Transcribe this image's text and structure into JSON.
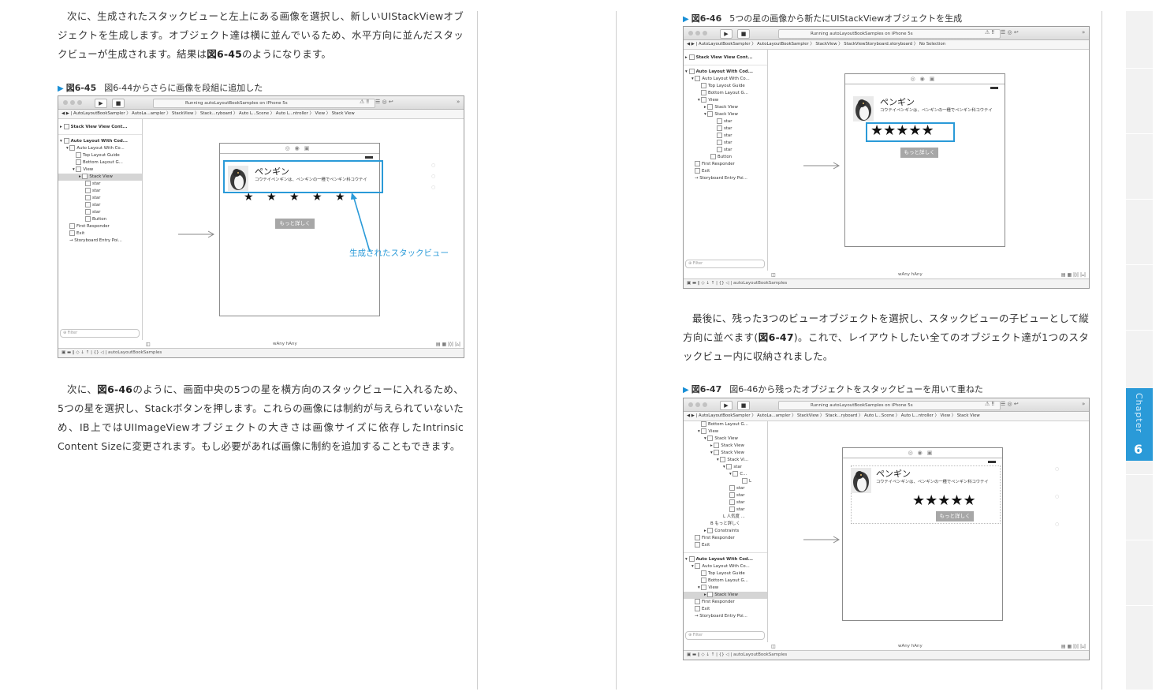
{
  "left_page": {
    "para1": "次に、生成されたスタックビューと左上にある画像を選択し、新しいUIStackViewオブジェクトを生成します。オブジェクト達は横に並んでいるため、水平方向に並んだスタックビューが生成されます。結果は",
    "para1_ref": "図6-45",
    "para1_tail": "のようになります。",
    "fig45_num": "図6-45",
    "fig45_caption": "図6-44からさらに画像を段組に追加した",
    "para2_a": "次に、",
    "para2_ref": "図6-46",
    "para2_b": "のように、画面中央の5つの星を横方向のスタックビューに入れるため、5つの星を選択し、Stackボタンを押します。これらの画像には制約が与えられていないため、IB上ではUIImageViewオブジェクトの大きさは画像サイズに依存したIntrinsic Content Sizeに変更されます。もし必要があれば画像に制約を追加することもできます。"
  },
  "right_page": {
    "fig46_num": "図6-46",
    "fig46_caption": "5つの星の画像から新たにUIStackViewオブジェクトを生成",
    "para3_a": "最後に、残った3つのビューオブジェクトを選択し、スタックビューの子ビューとして縦方向に並べます(",
    "para3_ref": "図6-47",
    "para3_b": ")。これで、レイアウトしたい全てのオブジェクト達が1つのスタックビュー内に収納されました。",
    "fig47_num": "図6-47",
    "fig47_caption": "図6-46から残ったオブジェクトをスタックビューを用いて重ねた"
  },
  "xcode": {
    "status": "Running autoLayoutBookSamples on iPhone 5s",
    "path45": "◀ ▶ | AutoLayoutBookSampler 〉 AutoLa...ampler 〉 StackView 〉 Stack...ryboard 〉 Auto L...Scene 〉 Auto L...ntroller 〉 View 〉 Stack View",
    "path46": "◀ ▶ | AutoLayoutBookSampler 〉 AutoLayoutBookSampler 〉 StackView 〉 StackViewStoryboard.storyboard 〉 No Selection",
    "path47": "◀ ▶ | AutoLayoutBookSampler 〉 AutoLa...ampler 〉 StackView 〉 Stack...ryboard 〉 Auto L...Scene 〉 Auto L...ntroller 〉 View 〉 Stack View",
    "size_class": "wAny hAny",
    "filter": "Filter",
    "target": "autoLayoutBookSamples",
    "penguin_title": "ペンギン",
    "penguin_desc": "コウテイペンギンは、ペンギンの一種でペンギン科コウテイ",
    "stars": "★ ★ ★ ★ ★",
    "stars_tight": "★★★★★",
    "more_button": "もっと詳しく",
    "annotation": "生成されたスタックビュー",
    "tree45": [
      "Stack View View Cont...",
      "Auto Layout With Cod...",
      "Auto Layout With Co...",
      "Top Layout Guide",
      "Bottom Layout G...",
      "View",
      "Stack View",
      "star",
      "star",
      "star",
      "star",
      "star",
      "Button",
      "First Responder",
      "Exit",
      "Storyboard Entry Poi..."
    ],
    "tree46": [
      "Stack View View Cont...",
      "Auto Layout With Cod...",
      "Auto Layout With Co...",
      "Top Layout Guide",
      "Bottom Layout G...",
      "View",
      "Stack View",
      "Stack View",
      "star",
      "star",
      "star",
      "star",
      "star",
      "Button",
      "First Responder",
      "Exit",
      "Storyboard Entry Poi..."
    ],
    "tree47": [
      "Bottom Layout G...",
      "View",
      "Stack View",
      "Stack View",
      "Stack View",
      "Stack Vi...",
      "star",
      "C...",
      "L",
      "star",
      "star",
      "star",
      "star",
      "L 人気度 ...",
      "B もっと詳しく",
      "Constraints",
      "First Responder",
      "Exit",
      "Auto Layout With Cod...",
      "Auto Layout With Co...",
      "Top Layout Guide",
      "Bottom Layout G...",
      "View",
      "Stack View",
      "First Responder",
      "Exit",
      "Storyboard Entry Poi..."
    ]
  },
  "chapter": {
    "word": "Chapter",
    "number": "6"
  }
}
